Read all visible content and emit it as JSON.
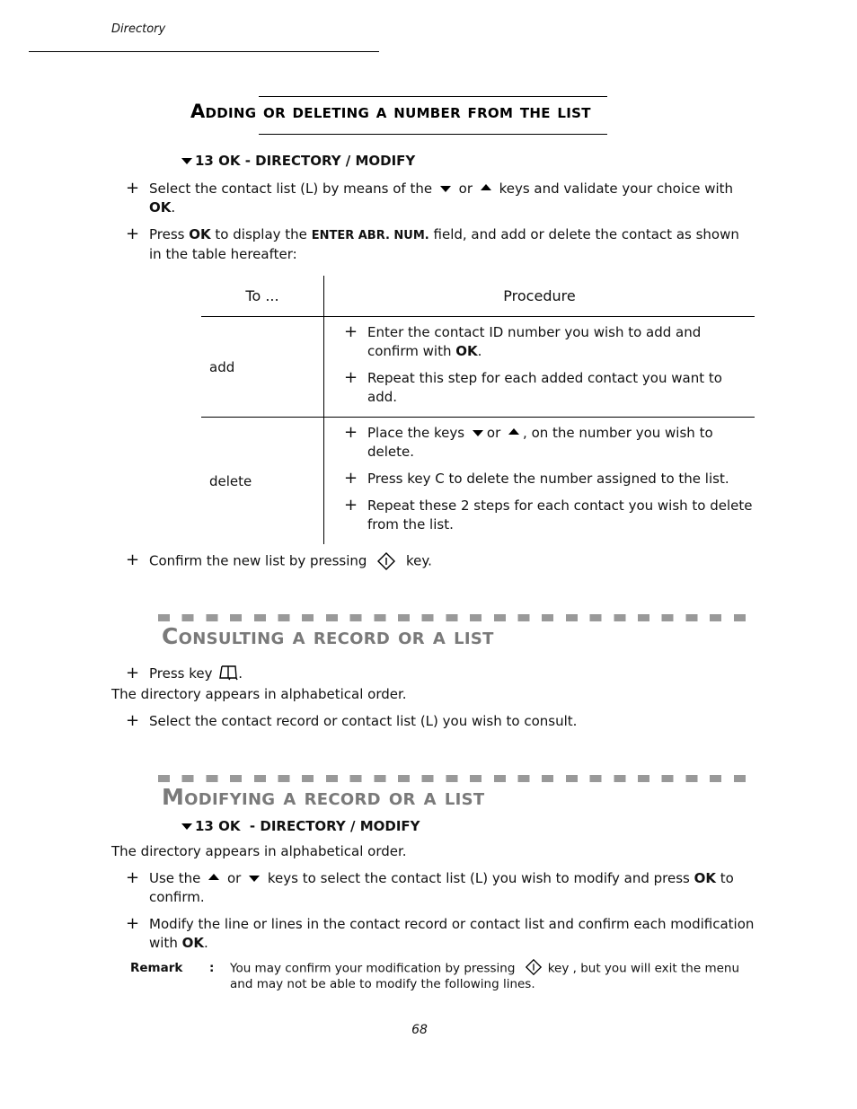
{
  "header": {
    "running_title": "Directory"
  },
  "section1": {
    "title": "Adding or deleting a number from the list",
    "menu_path": "13 OK - DIRECTORY / MODIFY",
    "menu_icon": "triangle-down-icon",
    "steps": [
      {
        "before": "Select the contact list (L) by means of the",
        "mid": "or",
        "after": "keys and validate your choice with",
        "bold": "OK",
        "end": "."
      },
      {
        "p1": "Press",
        "b1": "OK",
        "p2": "to display the",
        "b2": "ENTER ABR. NUM.",
        "p3": "field, and add or delete the contact as shown in the table hereafter:"
      }
    ],
    "table": {
      "headers": [
        "To ...",
        "Procedure"
      ],
      "rows": [
        {
          "action": "add",
          "items": [
            {
              "text": "Enter the contact ID number you wish to add and confirm with",
              "bold": "OK",
              "end": "."
            },
            {
              "text": "Repeat this step for each added contact you want to add."
            }
          ]
        },
        {
          "action": "delete",
          "items": [
            {
              "before": "Place the keys",
              "mid": "or",
              "after": ", on the number you wish to delete."
            },
            {
              "text": "Press key C to delete the number assigned to the list."
            },
            {
              "text": "Repeat these 2 steps for each contact you wish to delete from the list."
            }
          ]
        }
      ]
    },
    "confirm": {
      "before": "Confirm the new list by pressing",
      "after": "key.",
      "icon": "diamond-key-icon"
    }
  },
  "section2": {
    "title": "Consulting a record or a list",
    "press_key": {
      "before": "Press key",
      "after": ".",
      "icon": "directory-book-icon"
    },
    "note": "The directory appears in alphabetical order.",
    "step2": "Select the contact record or contact list (L) you wish to consult."
  },
  "section3": {
    "title": "Modifying a record or a list",
    "menu_path": "13 OK  - DIRECTORY / MODIFY",
    "note": "The directory appears in alphabetical order.",
    "steps": [
      {
        "before": "Use the",
        "mid": "or",
        "after": "keys to select the contact list (L) you wish to modify and press",
        "bold": "OK",
        "end": "to confirm."
      },
      {
        "text": "Modify the line or lines in the contact record or contact list and confirm each modification with",
        "bold": "OK",
        "end": "."
      }
    ],
    "remark": {
      "label": "Remark",
      "colon": ":",
      "before": "You may confirm your modification by pressing",
      "after": "key , but you will exit the menu and may not be able to modify the following lines."
    }
  },
  "footer": {
    "page_number": "68"
  },
  "colors": {
    "text": "#111111",
    "gray_title": "#7a7a7a",
    "dash": "#999999"
  }
}
